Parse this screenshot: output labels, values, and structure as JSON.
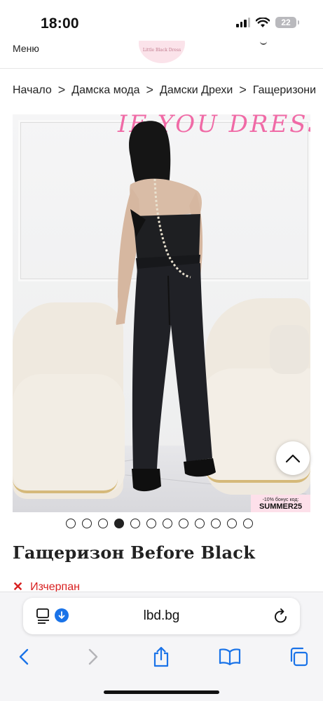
{
  "status_bar": {
    "time": "18:00",
    "battery": "22"
  },
  "header": {
    "menu_label": "Меню",
    "logo_text": "Little Black Dress"
  },
  "breadcrumb": {
    "items": [
      "Начало",
      "Дамска мода",
      "Дамски Дрехи",
      "Гащеризони"
    ],
    "separator": ">"
  },
  "product_image": {
    "wall_text": "IF YOU DRESS FOR I",
    "promo_line1": "-10% бонус код:",
    "promo_line2": "SUMMER25"
  },
  "gallery": {
    "total": 12,
    "active_index": 3
  },
  "product": {
    "title": "Гащеризон Before Black",
    "availability": "Изчерпан",
    "availability_icon": "✕"
  },
  "browser": {
    "url": "lbd.bg"
  },
  "colors": {
    "accent_red": "#d82020",
    "link_blue": "#1a73e8",
    "promo_pink": "#fde0ea"
  }
}
